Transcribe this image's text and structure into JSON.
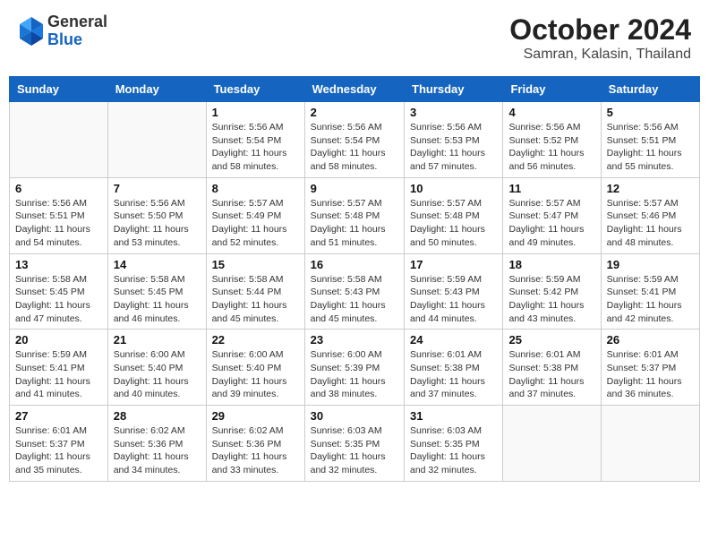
{
  "logo": {
    "general": "General",
    "blue": "Blue"
  },
  "title": "October 2024",
  "subtitle": "Samran, Kalasin, Thailand",
  "days_of_week": [
    "Sunday",
    "Monday",
    "Tuesday",
    "Wednesday",
    "Thursday",
    "Friday",
    "Saturday"
  ],
  "weeks": [
    [
      {
        "day": "",
        "info": ""
      },
      {
        "day": "",
        "info": ""
      },
      {
        "day": "1",
        "info": "Sunrise: 5:56 AM\nSunset: 5:54 PM\nDaylight: 11 hours\nand 58 minutes."
      },
      {
        "day": "2",
        "info": "Sunrise: 5:56 AM\nSunset: 5:54 PM\nDaylight: 11 hours\nand 58 minutes."
      },
      {
        "day": "3",
        "info": "Sunrise: 5:56 AM\nSunset: 5:53 PM\nDaylight: 11 hours\nand 57 minutes."
      },
      {
        "day": "4",
        "info": "Sunrise: 5:56 AM\nSunset: 5:52 PM\nDaylight: 11 hours\nand 56 minutes."
      },
      {
        "day": "5",
        "info": "Sunrise: 5:56 AM\nSunset: 5:51 PM\nDaylight: 11 hours\nand 55 minutes."
      }
    ],
    [
      {
        "day": "6",
        "info": "Sunrise: 5:56 AM\nSunset: 5:51 PM\nDaylight: 11 hours\nand 54 minutes."
      },
      {
        "day": "7",
        "info": "Sunrise: 5:56 AM\nSunset: 5:50 PM\nDaylight: 11 hours\nand 53 minutes."
      },
      {
        "day": "8",
        "info": "Sunrise: 5:57 AM\nSunset: 5:49 PM\nDaylight: 11 hours\nand 52 minutes."
      },
      {
        "day": "9",
        "info": "Sunrise: 5:57 AM\nSunset: 5:48 PM\nDaylight: 11 hours\nand 51 minutes."
      },
      {
        "day": "10",
        "info": "Sunrise: 5:57 AM\nSunset: 5:48 PM\nDaylight: 11 hours\nand 50 minutes."
      },
      {
        "day": "11",
        "info": "Sunrise: 5:57 AM\nSunset: 5:47 PM\nDaylight: 11 hours\nand 49 minutes."
      },
      {
        "day": "12",
        "info": "Sunrise: 5:57 AM\nSunset: 5:46 PM\nDaylight: 11 hours\nand 48 minutes."
      }
    ],
    [
      {
        "day": "13",
        "info": "Sunrise: 5:58 AM\nSunset: 5:45 PM\nDaylight: 11 hours\nand 47 minutes."
      },
      {
        "day": "14",
        "info": "Sunrise: 5:58 AM\nSunset: 5:45 PM\nDaylight: 11 hours\nand 46 minutes."
      },
      {
        "day": "15",
        "info": "Sunrise: 5:58 AM\nSunset: 5:44 PM\nDaylight: 11 hours\nand 45 minutes."
      },
      {
        "day": "16",
        "info": "Sunrise: 5:58 AM\nSunset: 5:43 PM\nDaylight: 11 hours\nand 45 minutes."
      },
      {
        "day": "17",
        "info": "Sunrise: 5:59 AM\nSunset: 5:43 PM\nDaylight: 11 hours\nand 44 minutes."
      },
      {
        "day": "18",
        "info": "Sunrise: 5:59 AM\nSunset: 5:42 PM\nDaylight: 11 hours\nand 43 minutes."
      },
      {
        "day": "19",
        "info": "Sunrise: 5:59 AM\nSunset: 5:41 PM\nDaylight: 11 hours\nand 42 minutes."
      }
    ],
    [
      {
        "day": "20",
        "info": "Sunrise: 5:59 AM\nSunset: 5:41 PM\nDaylight: 11 hours\nand 41 minutes."
      },
      {
        "day": "21",
        "info": "Sunrise: 6:00 AM\nSunset: 5:40 PM\nDaylight: 11 hours\nand 40 minutes."
      },
      {
        "day": "22",
        "info": "Sunrise: 6:00 AM\nSunset: 5:40 PM\nDaylight: 11 hours\nand 39 minutes."
      },
      {
        "day": "23",
        "info": "Sunrise: 6:00 AM\nSunset: 5:39 PM\nDaylight: 11 hours\nand 38 minutes."
      },
      {
        "day": "24",
        "info": "Sunrise: 6:01 AM\nSunset: 5:38 PM\nDaylight: 11 hours\nand 37 minutes."
      },
      {
        "day": "25",
        "info": "Sunrise: 6:01 AM\nSunset: 5:38 PM\nDaylight: 11 hours\nand 37 minutes."
      },
      {
        "day": "26",
        "info": "Sunrise: 6:01 AM\nSunset: 5:37 PM\nDaylight: 11 hours\nand 36 minutes."
      }
    ],
    [
      {
        "day": "27",
        "info": "Sunrise: 6:01 AM\nSunset: 5:37 PM\nDaylight: 11 hours\nand 35 minutes."
      },
      {
        "day": "28",
        "info": "Sunrise: 6:02 AM\nSunset: 5:36 PM\nDaylight: 11 hours\nand 34 minutes."
      },
      {
        "day": "29",
        "info": "Sunrise: 6:02 AM\nSunset: 5:36 PM\nDaylight: 11 hours\nand 33 minutes."
      },
      {
        "day": "30",
        "info": "Sunrise: 6:03 AM\nSunset: 5:35 PM\nDaylight: 11 hours\nand 32 minutes."
      },
      {
        "day": "31",
        "info": "Sunrise: 6:03 AM\nSunset: 5:35 PM\nDaylight: 11 hours\nand 32 minutes."
      },
      {
        "day": "",
        "info": ""
      },
      {
        "day": "",
        "info": ""
      }
    ]
  ]
}
